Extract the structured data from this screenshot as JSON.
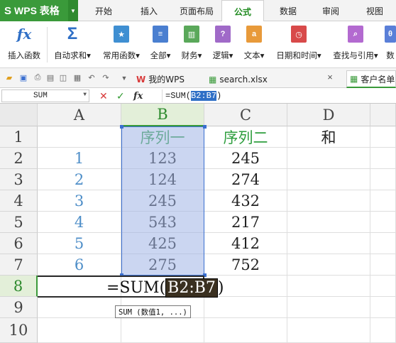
{
  "app": {
    "name": "WPS 表格"
  },
  "tabs": [
    {
      "label": "开始"
    },
    {
      "label": "插入"
    },
    {
      "label": "页面布局"
    },
    {
      "label": "公式",
      "active": true
    },
    {
      "label": "数据"
    },
    {
      "label": "审阅"
    },
    {
      "label": "视图"
    }
  ],
  "ribbon": [
    {
      "label": "插入函数",
      "icon": "fx-icon"
    },
    {
      "label": "自动求和▾",
      "icon": "sigma-icon"
    },
    {
      "label": "常用函数▾",
      "icon": "star-book-icon"
    },
    {
      "label": "全部▾",
      "icon": "list-book-icon"
    },
    {
      "label": "财务▾",
      "icon": "finance-book-icon"
    },
    {
      "label": "逻辑▾",
      "icon": "logic-book-icon"
    },
    {
      "label": "文本▾",
      "icon": "text-book-icon"
    },
    {
      "label": "日期和时间▾",
      "icon": "clock-book-icon"
    },
    {
      "label": "查找与引用▾",
      "icon": "search-book-icon"
    },
    {
      "label": "数",
      "icon": "math-book-icon"
    }
  ],
  "doc_tabs": [
    {
      "label": "我的WPS",
      "icon": "wps-logo-icon"
    },
    {
      "label": "search.xlsx",
      "icon": "sheet-file-icon"
    },
    {
      "label": "客户名单",
      "icon": "sheet-file-icon",
      "active": true
    }
  ],
  "formula_bar": {
    "name_box": "SUM",
    "fx": "fx",
    "formula_prefix": "=SUM(",
    "formula_ref": "B2:B7",
    "formula_suffix": ")"
  },
  "columns": [
    "A",
    "B",
    "C",
    "D"
  ],
  "rows": [
    "1",
    "2",
    "3",
    "4",
    "5",
    "6",
    "7",
    "8",
    "9",
    "10"
  ],
  "cells": {
    "B1": "序列一",
    "C1": "序列二",
    "D1": "和",
    "A2": "1",
    "A3": "2",
    "A4": "3",
    "A5": "4",
    "A6": "5",
    "A7": "6",
    "B2": "123",
    "B3": "124",
    "B4": "245",
    "B5": "543",
    "B6": "425",
    "B7": "275",
    "C2": "245",
    "C3": "274",
    "C4": "432",
    "C5": "217",
    "C6": "412",
    "C7": "752"
  },
  "editing": {
    "prefix": "=SUM(",
    "ref": "B2:B7",
    "suffix": ")"
  },
  "tooltip": "SUM (数值1, ...)",
  "colors": {
    "accent": "#3a9a3a",
    "selection": "#a0b4e6",
    "header_text": "#2e9e3e",
    "index_text": "#4e8ec8"
  }
}
